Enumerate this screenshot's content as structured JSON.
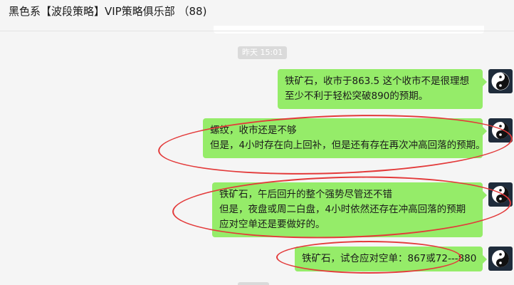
{
  "header": {
    "chat_title": "黑色系【波段策略】VIP策略俱乐部 （88)"
  },
  "timestamp": "昨天 15:01",
  "messages": [
    {
      "sender": "self",
      "lines": [
        "铁矿石，收市于863.5 这个收市不是很理想",
        "至少不利于轻松突破890的预期。"
      ]
    },
    {
      "sender": "self",
      "lines": [
        "螺纹，收市还是不够",
        "但是，4小时存在向上回补，但是还有存在再次冲高回落的预期。"
      ]
    },
    {
      "sender": "self",
      "lines": [
        "铁矿石，午后回升的整个强势尽管还不错",
        "但是，夜盘或周二白盘，4小时依然还存在冲高回落的预期",
        "应对空单还是要做好的。"
      ]
    },
    {
      "sender": "self",
      "lines": [
        "铁矿石，试仓应对空单：867或72---880"
      ]
    }
  ],
  "avatar_icon": "yin-yang-icon",
  "colors": {
    "bubble": "#95ec69",
    "background": "#f5f5f5",
    "annotation": "#e33a3a",
    "avatar_bg": "#1f2c3b"
  }
}
